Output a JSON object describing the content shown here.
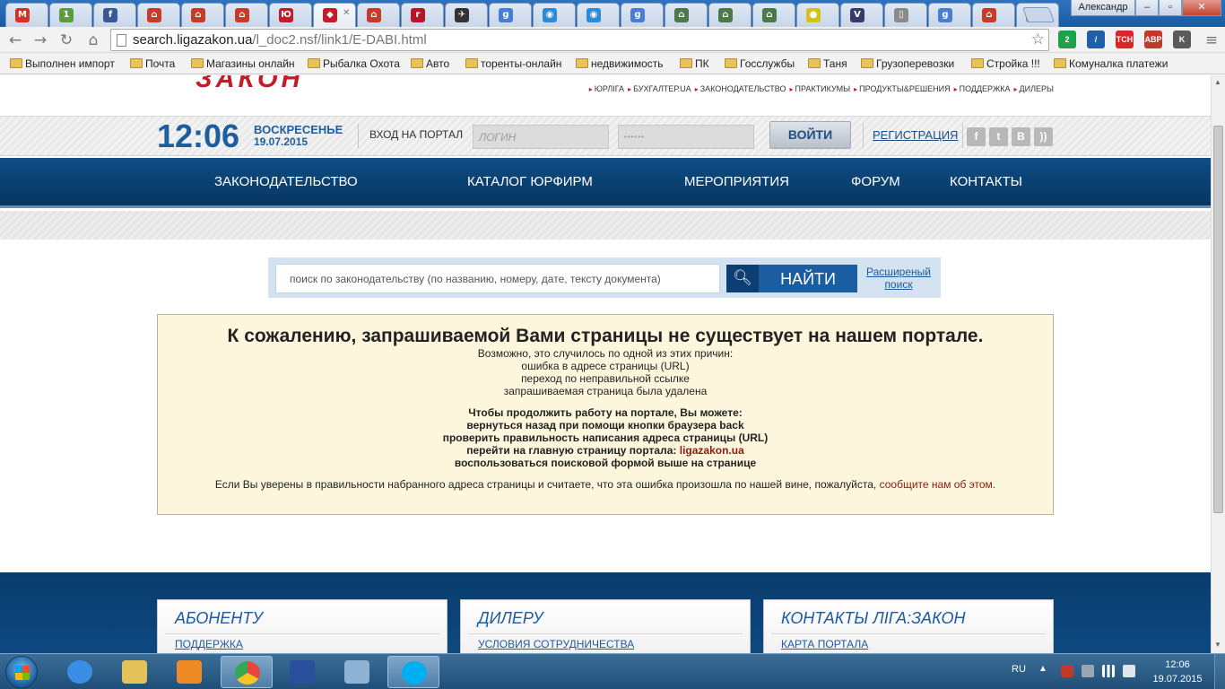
{
  "browser": {
    "user_name": "Александр",
    "url_host": "search.ligazakon.ua",
    "url_path": "/l_doc2.nsf/link1/E-DABI.html",
    "tabs": [
      {
        "icon": "gmail-icon",
        "label": "M",
        "color": "#d93025"
      },
      {
        "icon": "sheet-icon",
        "label": "1",
        "color": "#5c9c3c"
      },
      {
        "icon": "facebook-icon",
        "label": "f",
        "color": "#3b5998"
      },
      {
        "icon": "house-icon",
        "label": "⌂",
        "color": "#c83a2a"
      },
      {
        "icon": "house-icon",
        "label": "⌂",
        "color": "#c83a2a"
      },
      {
        "icon": "house-icon",
        "label": "⌂",
        "color": "#c83a2a"
      },
      {
        "icon": "yu-icon",
        "label": "Ю",
        "color": "#c31c28"
      },
      {
        "icon": "liga-icon",
        "label": "◆",
        "color": "#c31c28"
      },
      {
        "icon": "house-icon",
        "label": "⌂",
        "color": "#c83a2a"
      },
      {
        "icon": "r-icon",
        "label": "r",
        "color": "#b4162a"
      },
      {
        "icon": "fish-icon",
        "label": "✈",
        "color": "#333333"
      },
      {
        "icon": "google-icon",
        "label": "g",
        "color": "#4a7ed6"
      },
      {
        "icon": "circle-icon",
        "label": "◉",
        "color": "#2d8ad6"
      },
      {
        "icon": "circle-icon",
        "label": "◉",
        "color": "#2d8ad6"
      },
      {
        "icon": "google-icon",
        "label": "g",
        "color": "#4a7ed6"
      },
      {
        "icon": "building-icon",
        "label": "⌂",
        "color": "#4a7a4a"
      },
      {
        "icon": "building-icon",
        "label": "⌂",
        "color": "#4a7a4a"
      },
      {
        "icon": "building-icon",
        "label": "⌂",
        "color": "#4a7a4a"
      },
      {
        "icon": "yellow-icon",
        "label": "●",
        "color": "#d4c21a"
      },
      {
        "icon": "v-icon",
        "label": "V",
        "color": "#3a3a6a"
      },
      {
        "icon": "doc-icon",
        "label": "▯",
        "color": "#8a8a8a"
      },
      {
        "icon": "google-icon",
        "label": "g",
        "color": "#4a7ed6"
      },
      {
        "icon": "house-icon",
        "label": "⌂",
        "color": "#c83a2a"
      },
      {
        "icon": "doc-icon",
        "label": "▯",
        "color": "#8a8a8a"
      }
    ],
    "extensions": [
      {
        "icon": "green-ext-icon",
        "label": "2",
        "color": "#1fa14a"
      },
      {
        "icon": "pen-ext-icon",
        "label": "/",
        "color": "#1f5fa8"
      },
      {
        "icon": "tsn-ext-icon",
        "label": "TCH",
        "color": "#d8262a"
      },
      {
        "icon": "abp-ext-icon",
        "label": "ABP",
        "color": "#c0392b"
      },
      {
        "icon": "k-ext-icon",
        "label": "K",
        "color": "#5a5a5a"
      }
    ],
    "bookmarks": [
      "Выполнен импорт",
      "Почта",
      "Магазины онлайн",
      "Рыбалка Охота",
      "Авто",
      "торенты-онлайн",
      "недвижимость",
      "ПК",
      "Госслужбы",
      "Таня",
      "Грузоперевозки",
      "Стройка !!!",
      "Комуналка платежи"
    ]
  },
  "site": {
    "logo_text": "ЗАКОН",
    "top_links": [
      "ЮРЛІГА",
      "БУХГАЛТЕР.UA",
      "ЗАКОНОДАТЕЛЬСТВО",
      "ПРАКТИКУМЫ",
      "ПРОДУКТЫ&РЕШЕНИЯ",
      "ПОДДЕРЖКА",
      "ДИЛЕРЫ"
    ],
    "clock": {
      "time": "12:06",
      "day": "ВОСКРЕСЕНЬЕ",
      "date": "19.07.2015"
    },
    "login": {
      "label": "ВХОД НА ПОРТАЛ",
      "login_placeholder": "ЛОГИН",
      "password_value": "••••••",
      "button": "ВОЙТИ",
      "register": "РЕГИСТРАЦИЯ"
    },
    "social": [
      {
        "icon": "facebook-icon",
        "label": "f"
      },
      {
        "icon": "twitter-icon",
        "label": "t"
      },
      {
        "icon": "vk-icon",
        "label": "B"
      },
      {
        "icon": "rss-icon",
        "label": "))"
      }
    ],
    "nav": [
      "ЗАКОНОДАТЕЛЬСТВО",
      "КАТАЛОГ ЮРФИРМ",
      "МЕРОПРИЯТИЯ",
      "ФОРУМ",
      "КОНТАКТЫ"
    ],
    "search": {
      "placeholder": "поиск по законодательству (по названию, номеру, дате, тексту документа)",
      "button": "НАЙТИ",
      "advanced_line1": "Расширеный",
      "advanced_line2": "поиск"
    },
    "error": {
      "title": "К сожалению, запрашиваемой Вами страницы не существует на нашем портале.",
      "intro": "Возможно, это случилось по одной из этих причин:",
      "reasons": [
        "ошибка в адресе страницы (URL)",
        "переход по неправильной ссылке",
        "запрашиваемая страница была удалена"
      ],
      "actions_title": "Чтобы продолжить работу на портале, Вы можете:",
      "actions": [
        "вернуться назад при помощи кнопки браузера back",
        "проверить правильность написания адреса страницы (URL)"
      ],
      "home_prefix": "перейти на главную страницу портала: ",
      "home_link": "ligazakon.ua",
      "last_action": "воспользоваться поисковой формой выше на странице",
      "report_prefix": "Если Вы уверены в правильности набранного адреса страницы и считаете, что эта ошибка произошла по нашей вине, пожалуйста, ",
      "report_link": "сообщите нам об этом."
    },
    "footer": [
      {
        "title": "АБОНЕНТУ",
        "link": "ПОДДЕРЖКА"
      },
      {
        "title": "ДИЛЕРУ",
        "link": "УСЛОВИЯ СОТРУДНИЧЕСТВА"
      },
      {
        "title": "КОНТАКТЫ ЛІГА:ЗАКОН",
        "link": "КАРТА ПОРТАЛА"
      }
    ]
  },
  "taskbar": {
    "apps": [
      {
        "icon": "ie-icon",
        "color": "#3a8ee6"
      },
      {
        "icon": "explorer-icon",
        "color": "#e4c15a"
      },
      {
        "icon": "media-player-icon",
        "color": "#f08a24"
      },
      {
        "icon": "chrome-icon",
        "color": "#e8453c"
      },
      {
        "icon": "floppy-icon",
        "color": "#2a4f9c"
      },
      {
        "icon": "calculator-icon",
        "color": "#8fb3d4"
      },
      {
        "icon": "skype-icon",
        "color": "#00aff0"
      }
    ],
    "lang": "RU",
    "time": "12:06",
    "date": "19.07.2015"
  }
}
